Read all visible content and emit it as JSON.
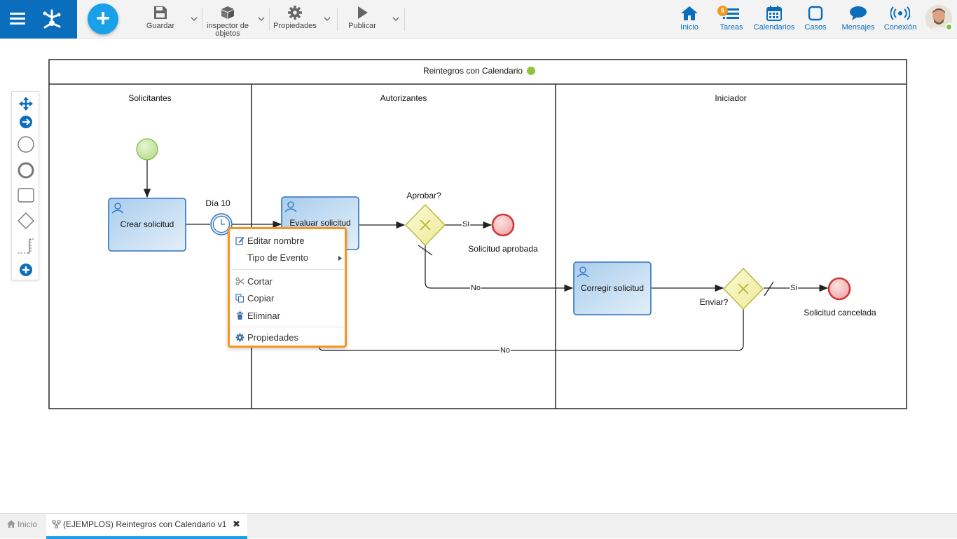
{
  "toolbar": {
    "save": "Guardar",
    "inspector_line1": "inspector de",
    "inspector_line2": "objetos",
    "properties": "Propiedades",
    "publish": "Publicar"
  },
  "nav": {
    "home": "Inicio",
    "tasks": "Tareas",
    "tasks_badge": "5",
    "calendars": "Calendarios",
    "cases": "Casos",
    "messages": "Mensajes",
    "connection": "Conexión"
  },
  "diagram": {
    "pool_title": "Reintegros con Calendario",
    "lanes": [
      "Solicitantes",
      "Autorizantes",
      "Iniciador"
    ],
    "tasks": {
      "create": "Crear solicitud",
      "evaluate": "Evaluar solicitud",
      "correct": "Corregir solicitud"
    },
    "timer_label": "Día 10",
    "gateway_approve": "Aprobar?",
    "gateway_send": "Enviar?",
    "end_approved": "Solicitud aprobada",
    "end_cancelled": "Solicitud cancelada",
    "flow_yes_1": "Si",
    "flow_yes_2": "Si",
    "flow_no_1": "No",
    "flow_no_2": "No"
  },
  "context_menu": {
    "edit_name": "Editar nombre",
    "event_type": "Tipo de Evento",
    "cut": "Cortar",
    "copy": "Copiar",
    "delete": "Eliminar",
    "properties": "Propiedades"
  },
  "tabs": {
    "home": "Inicio",
    "document": "(EJEMPLOS) Reintegros con Calendario v1"
  },
  "colors": {
    "brand_blue": "#0a6ebd",
    "accent_blue": "#1aa0e8",
    "highlight_orange": "#f7931e",
    "start_green": "#c9e7a8",
    "end_red": "#f2b8b8",
    "gateway_yellow": "#f4f3b0",
    "task_blue": "#bcd8f0",
    "status_green": "#7cc242"
  }
}
